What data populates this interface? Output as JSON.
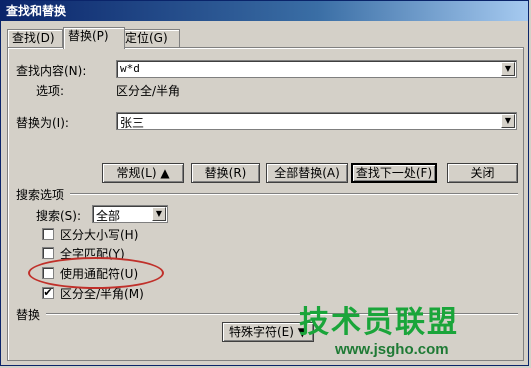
{
  "window": {
    "title": "查找和替换"
  },
  "tabs": [
    {
      "label": "查找(D)"
    },
    {
      "label": "替换(P)",
      "active": true
    },
    {
      "label": "定位(G)"
    }
  ],
  "find": {
    "label": "查找内容(N):",
    "value": "w*d",
    "options_label": "选项:",
    "options_value": "区分全/半角"
  },
  "replace": {
    "label": "替换为(I):",
    "value": "张三"
  },
  "buttons": {
    "more": "常规(L) ▲",
    "replace": "替换(R)",
    "replace_all": "全部替换(A)",
    "find_next": "查找下一处(F)",
    "close": "关闭"
  },
  "search_options": {
    "group_label": "搜索选项",
    "search_label": "搜索(S):",
    "search_value": "全部",
    "checkboxes": [
      {
        "label": "区分大小写(H)",
        "checked": false
      },
      {
        "label": "全字匹配(Y)",
        "checked": false
      },
      {
        "label": "使用通配符(U)",
        "checked": false
      },
      {
        "label": "区分全/半角(M)",
        "checked": true
      }
    ]
  },
  "replace_section": {
    "group_label": "替换",
    "special_button": "特殊字符(E) ▼"
  },
  "watermark": {
    "title": "技术员联盟",
    "url": "www.jsgho.com"
  },
  "colors": {
    "accent_red": "#c0302a",
    "watermark_green": "#1aa53a",
    "title_bar": "#0a246a"
  }
}
